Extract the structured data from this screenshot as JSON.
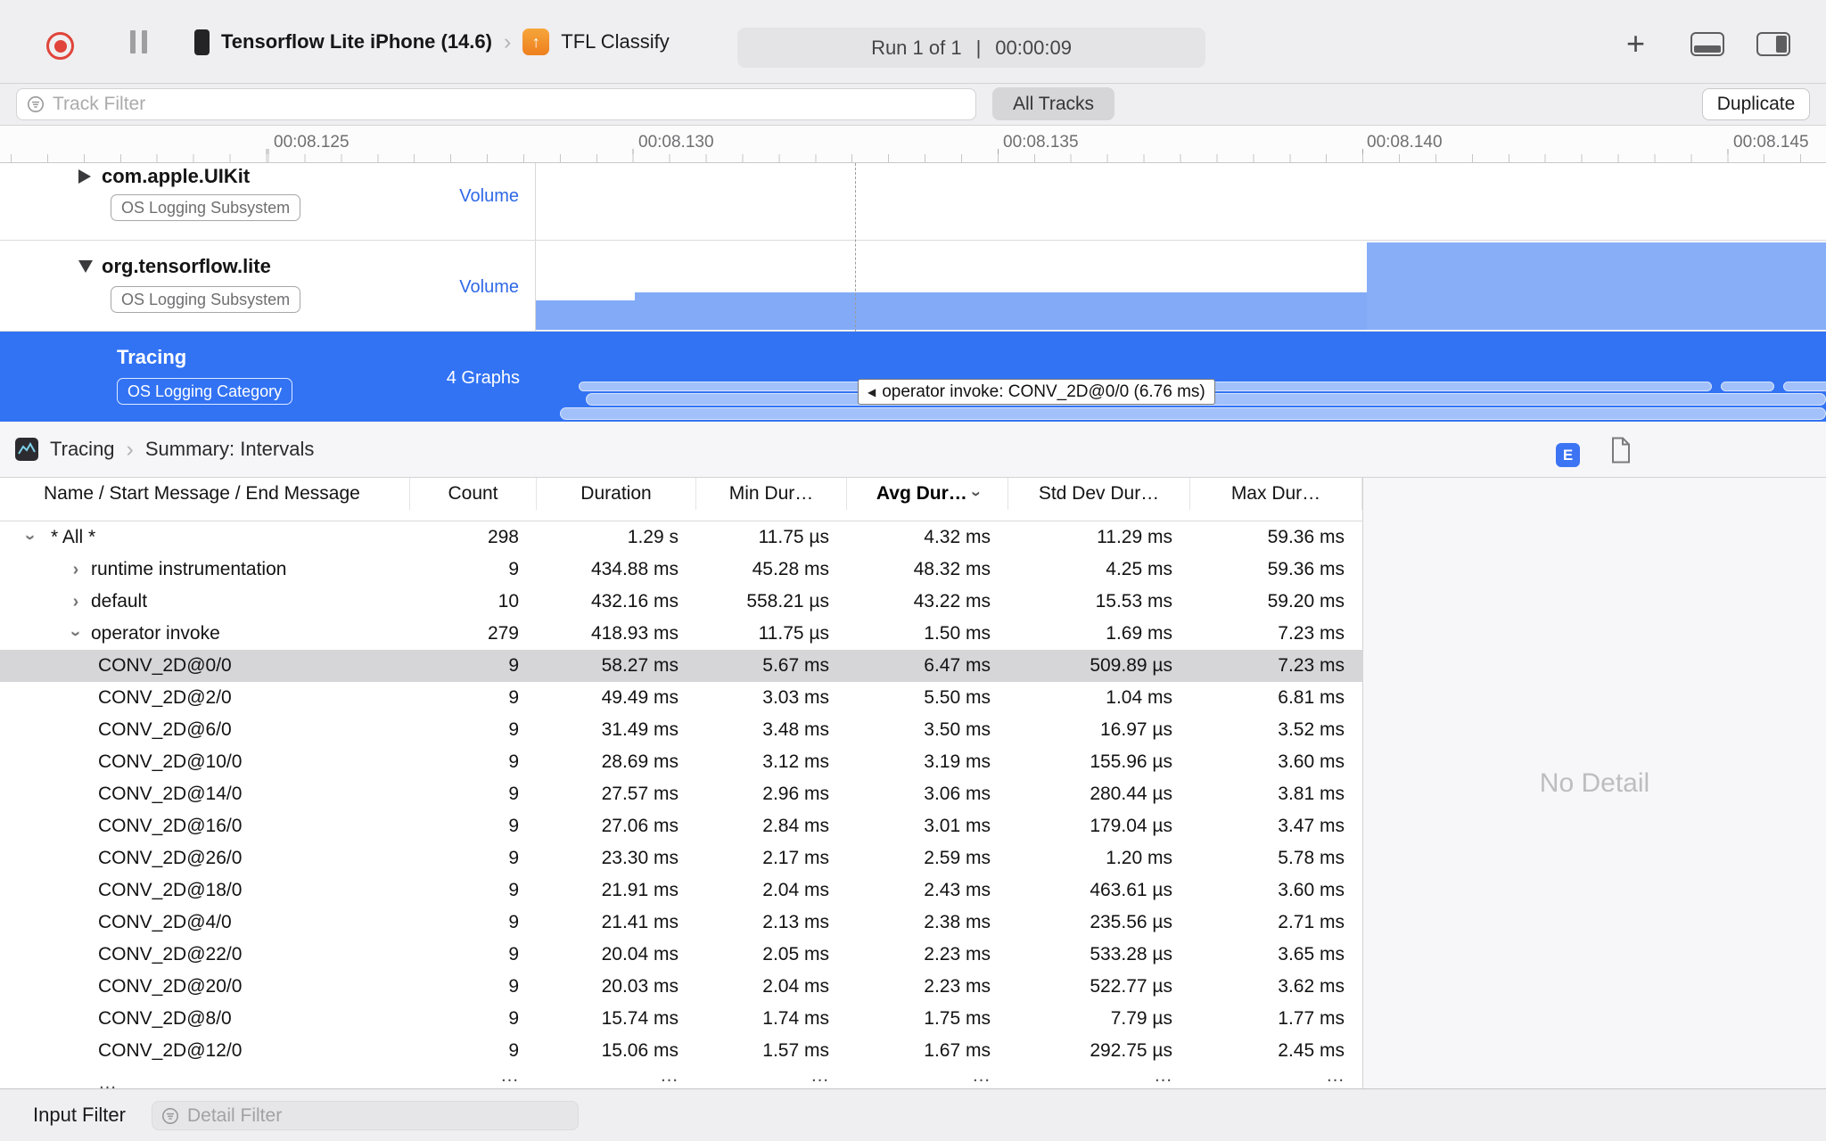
{
  "toolbar": {
    "device_name": "Tensorflow Lite iPhone (14.6)",
    "target_name": "TFL Classify",
    "run": {
      "runs": "Run 1 of 1",
      "divider": "|",
      "time": "00:00:09"
    }
  },
  "filter_bar": {
    "track_filter_placeholder": "Track Filter",
    "all_tracks_label": "All Tracks",
    "duplicate_label": "Duplicate"
  },
  "ruler": {
    "ticks": [
      "00:08.125",
      "00:08.130",
      "00:08.135",
      "00:08.140",
      "00:08.145"
    ]
  },
  "tracks": [
    {
      "title": "com.apple.UIKit",
      "badge": "OS Logging Subsystem",
      "meta": "Volume",
      "expanded": false
    },
    {
      "title": "org.tensorflow.lite",
      "badge": "OS Logging Subsystem",
      "meta": "Volume",
      "expanded": true
    },
    {
      "title": "Tracing",
      "badge": "OS Logging Category",
      "meta": "4 Graphs",
      "selected": true,
      "tooltip": "operator invoke: CONV_2D@0/0 (6.76 ms)"
    }
  ],
  "detail": {
    "breadcrumb": {
      "root": "Tracing",
      "page": "Summary: Intervals"
    },
    "inspector_badge": "E",
    "no_detail": "No Detail"
  },
  "table": {
    "columns": [
      {
        "key": "name",
        "label": "Name / Start Message / End Message"
      },
      {
        "key": "count",
        "label": "Count"
      },
      {
        "key": "duration",
        "label": "Duration"
      },
      {
        "key": "min",
        "label": "Min Dur…"
      },
      {
        "key": "avg",
        "label": "Avg Dur…",
        "sorted": true
      },
      {
        "key": "std",
        "label": "Std Dev Dur…"
      },
      {
        "key": "max",
        "label": "Max Dur…"
      }
    ],
    "truncated_row_hint": "…",
    "rows": [
      {
        "name": "* All *",
        "level": 1,
        "expander": "down",
        "count": "298",
        "duration": "1.29 s",
        "min": "11.75 µs",
        "avg": "4.32 ms",
        "std": "11.29 ms",
        "max": "59.36 ms"
      },
      {
        "name": "runtime instrumentation",
        "level": 2,
        "expander": "right",
        "count": "9",
        "duration": "434.88 ms",
        "min": "45.28 ms",
        "avg": "48.32 ms",
        "std": "4.25 ms",
        "max": "59.36 ms"
      },
      {
        "name": "default",
        "level": 2,
        "expander": "right",
        "count": "10",
        "duration": "432.16 ms",
        "min": "558.21 µs",
        "avg": "43.22 ms",
        "std": "15.53 ms",
        "max": "59.20 ms"
      },
      {
        "name": "operator invoke",
        "level": 2,
        "expander": "down",
        "count": "279",
        "duration": "418.93 ms",
        "min": "11.75 µs",
        "avg": "1.50 ms",
        "std": "1.69 ms",
        "max": "7.23 ms"
      },
      {
        "name": "CONV_2D@0/0",
        "level": 3,
        "selected": true,
        "count": "9",
        "duration": "58.27 ms",
        "min": "5.67 ms",
        "avg": "6.47 ms",
        "std": "509.89 µs",
        "max": "7.23 ms"
      },
      {
        "name": "CONV_2D@2/0",
        "level": 3,
        "count": "9",
        "duration": "49.49 ms",
        "min": "3.03 ms",
        "avg": "5.50 ms",
        "std": "1.04 ms",
        "max": "6.81 ms"
      },
      {
        "name": "CONV_2D@6/0",
        "level": 3,
        "count": "9",
        "duration": "31.49 ms",
        "min": "3.48 ms",
        "avg": "3.50 ms",
        "std": "16.97 µs",
        "max": "3.52 ms"
      },
      {
        "name": "CONV_2D@10/0",
        "level": 3,
        "count": "9",
        "duration": "28.69 ms",
        "min": "3.12 ms",
        "avg": "3.19 ms",
        "std": "155.96 µs",
        "max": "3.60 ms"
      },
      {
        "name": "CONV_2D@14/0",
        "level": 3,
        "count": "9",
        "duration": "27.57 ms",
        "min": "2.96 ms",
        "avg": "3.06 ms",
        "std": "280.44 µs",
        "max": "3.81 ms"
      },
      {
        "name": "CONV_2D@16/0",
        "level": 3,
        "count": "9",
        "duration": "27.06 ms",
        "min": "2.84 ms",
        "avg": "3.01 ms",
        "std": "179.04 µs",
        "max": "3.47 ms"
      },
      {
        "name": "CONV_2D@26/0",
        "level": 3,
        "count": "9",
        "duration": "23.30 ms",
        "min": "2.17 ms",
        "avg": "2.59 ms",
        "std": "1.20 ms",
        "max": "5.78 ms"
      },
      {
        "name": "CONV_2D@18/0",
        "level": 3,
        "count": "9",
        "duration": "21.91 ms",
        "min": "2.04 ms",
        "avg": "2.43 ms",
        "std": "463.61 µs",
        "max": "3.60 ms"
      },
      {
        "name": "CONV_2D@4/0",
        "level": 3,
        "count": "9",
        "duration": "21.41 ms",
        "min": "2.13 ms",
        "avg": "2.38 ms",
        "std": "235.56 µs",
        "max": "2.71 ms"
      },
      {
        "name": "CONV_2D@22/0",
        "level": 3,
        "count": "9",
        "duration": "20.04 ms",
        "min": "2.05 ms",
        "avg": "2.23 ms",
        "std": "533.28 µs",
        "max": "3.65 ms"
      },
      {
        "name": "CONV_2D@20/0",
        "level": 3,
        "count": "9",
        "duration": "20.03 ms",
        "min": "2.04 ms",
        "avg": "2.23 ms",
        "std": "522.77 µs",
        "max": "3.62 ms"
      },
      {
        "name": "CONV_2D@8/0",
        "level": 3,
        "count": "9",
        "duration": "15.74 ms",
        "min": "1.74 ms",
        "avg": "1.75 ms",
        "std": "7.79 µs",
        "max": "1.77 ms"
      },
      {
        "name": "CONV_2D@12/0",
        "level": 3,
        "count": "9",
        "duration": "15.06 ms",
        "min": "1.57 ms",
        "avg": "1.67 ms",
        "std": "292.75 µs",
        "max": "2.45 ms"
      }
    ]
  },
  "bottom_bar": {
    "label": "Input Filter",
    "detail_filter_placeholder": "Detail Filter"
  },
  "icons": {
    "record-icon": "red circle",
    "pause-icon": "❚❚",
    "filter-icon": "funnel in circle",
    "add-icon": "+",
    "chevron": "›",
    "disclosure-right": "▶",
    "disclosure-down": "▼"
  },
  "colors": {
    "selection_blue": "#3273f4",
    "track_bar_blue": "#82aaf6",
    "record_red": "#e0443a",
    "selected_row_gray": "#d6d5d7"
  }
}
